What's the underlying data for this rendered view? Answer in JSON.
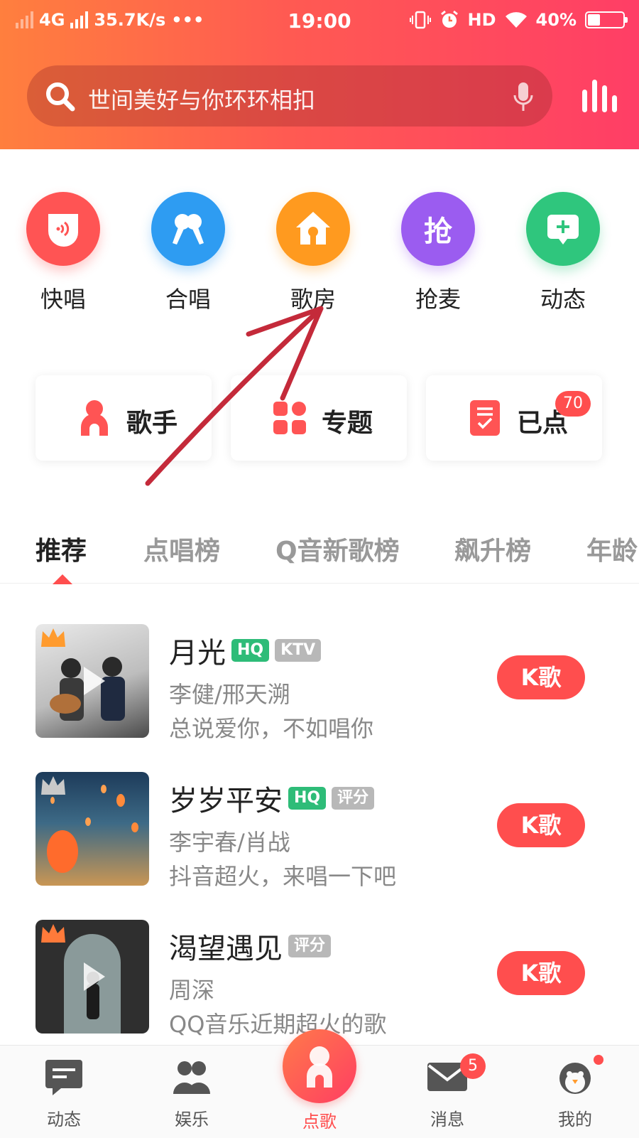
{
  "status_bar": {
    "network": "4G",
    "speed": "35.7K/s",
    "more": "•••",
    "time": "19:00",
    "hd": "HD",
    "battery_text": "40%",
    "battery_level": 0.4
  },
  "search": {
    "placeholder": "世间美好与你环环相扣"
  },
  "shortcuts": [
    {
      "label": "快唱",
      "icon": "quick-sing-icon",
      "color": "#ff5454"
    },
    {
      "label": "合唱",
      "icon": "chorus-icon",
      "color": "#2e9cf2"
    },
    {
      "label": "歌房",
      "icon": "song-room-icon",
      "color": "#ff9a1f"
    },
    {
      "label": "抢麦",
      "icon": "grab-mic-icon",
      "color": "#9b5cf0"
    },
    {
      "label": "动态",
      "icon": "post-icon",
      "color": "#2fc67d"
    }
  ],
  "cards": [
    {
      "label": "歌手",
      "icon": "singer-icon"
    },
    {
      "label": "专题",
      "icon": "topic-icon"
    },
    {
      "label": "已点",
      "icon": "ordered-list-icon",
      "badge": "70"
    }
  ],
  "tabs": [
    "推荐",
    "点唱榜",
    "Q音新歌榜",
    "飙升榜",
    "年龄"
  ],
  "songs": [
    {
      "title": "月光",
      "tags": [
        "HQ",
        "KTV"
      ],
      "artist": "李健/邢天溯",
      "desc": "总说爱你，不如唱你",
      "button": "K歌",
      "crown_color": "#ff9b2e"
    },
    {
      "title": "岁岁平安",
      "tags": [
        "HQ",
        "评分"
      ],
      "artist": "李宇春/肖战",
      "desc": "抖音超火，来唱一下吧",
      "button": "K歌",
      "crown_color": "#c9c9c9"
    },
    {
      "title": "渴望遇见",
      "tags": [
        "评分"
      ],
      "artist": "周深",
      "desc": "QQ音乐近期超火的歌",
      "button": "K歌",
      "crown_color": "#ff7a3a"
    }
  ],
  "bottom_nav": [
    {
      "label": "动态",
      "icon": "feed-icon"
    },
    {
      "label": "娱乐",
      "icon": "entertainment-icon"
    },
    {
      "label": "点歌",
      "icon": "sing-icon"
    },
    {
      "label": "消息",
      "icon": "message-icon",
      "badge": "5"
    },
    {
      "label": "我的",
      "icon": "profile-icon"
    }
  ],
  "colors": {
    "accent": "#ff4e4e",
    "header_start": "#ff7f3e",
    "header_end": "#ff3e66",
    "hq_tag": "#2ebc78"
  }
}
